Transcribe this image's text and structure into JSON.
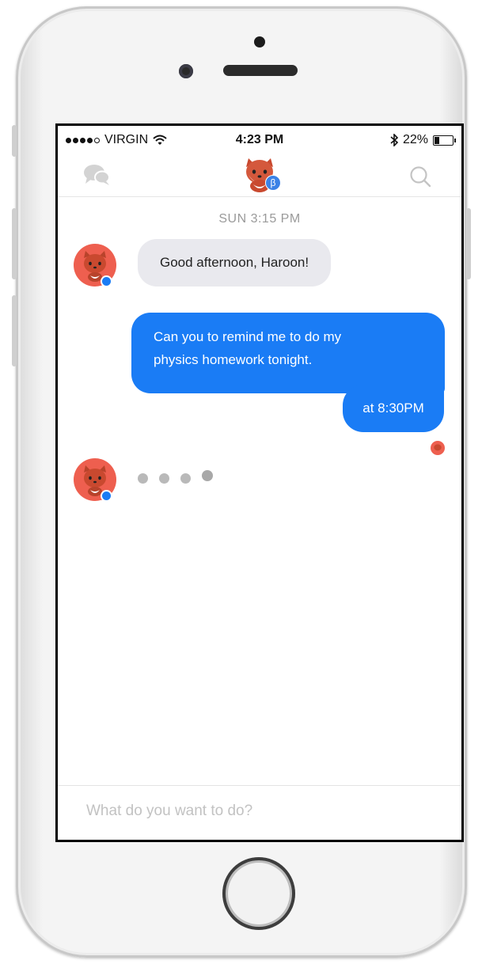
{
  "status_bar": {
    "carrier": "VIRGIN",
    "time": "4:23 PM",
    "battery": "22%",
    "battery_level": 0.22,
    "signal_bars": 4
  },
  "nav": {
    "left_icon": "chat-bubbles-icon",
    "center_icon": "fox-mascot-icon",
    "beta_badge": "β",
    "right_icon": "search-icon"
  },
  "conversation": {
    "timestamp": "SUN 3:15 PM",
    "messages": [
      {
        "from": "bot",
        "text": "Good afternoon, Haroon!"
      },
      {
        "from": "user",
        "lines": [
          "Can you to remind me to do my",
          "physics homework tonight."
        ]
      },
      {
        "from": "user",
        "text": "at 8:30PM"
      }
    ],
    "typing_indicator": true
  },
  "composer": {
    "placeholder": "What do you want to do?",
    "value": ""
  },
  "colors": {
    "accent": "#1a7cf5",
    "mascot": "#ee5f4f",
    "incoming_bubble": "#e9e9ee"
  }
}
